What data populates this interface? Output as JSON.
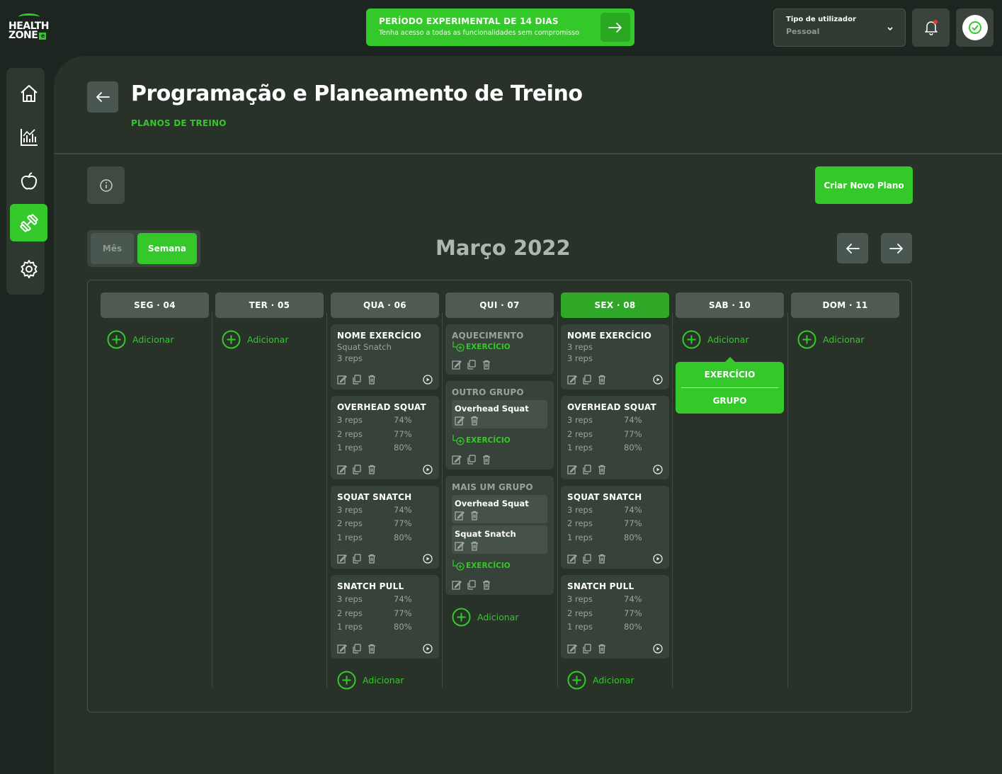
{
  "brand": {
    "line1": "HEALTH",
    "line2": "ZONE",
    "badge": "e"
  },
  "trial": {
    "title": "PERÍODO EXPERIMENTAL DE 14 DIAS",
    "subtitle": "Tenha acesso a todas as funcionalidades sem compromisso",
    "icon": "arrow-right-icon"
  },
  "user_type": {
    "label": "Tipo de utilizador",
    "value": "Pessoal"
  },
  "colors": {
    "accent": "#35c82a",
    "background": "#1c2520",
    "panel": "#283229",
    "card": "#37423a",
    "notification": "#e53b2c"
  },
  "sidebar": {
    "items": [
      {
        "name": "home",
        "icon": "home-icon",
        "active": false
      },
      {
        "name": "stats",
        "icon": "chart-icon",
        "active": false
      },
      {
        "name": "nutrition",
        "icon": "apple-icon",
        "active": false
      },
      {
        "name": "training",
        "icon": "dumbbell-icon",
        "active": true
      },
      {
        "name": "settings",
        "icon": "gear-icon",
        "active": false
      }
    ]
  },
  "page": {
    "title": "Programação e Planeamento de Treino",
    "subtitle": "PLANOS DE TREINO",
    "create_button": "Criar Novo Plano"
  },
  "view_toggle": {
    "month": "Mês",
    "week": "Semana",
    "selected": "Semana"
  },
  "calendar": {
    "month_label": "Março 2022",
    "add_label": "Adicionar",
    "days": [
      {
        "label": "SEG · 04"
      },
      {
        "label": "TER · 05"
      },
      {
        "label": "QUA · 06"
      },
      {
        "label": "QUI · 07"
      },
      {
        "label": "SEX · 08"
      },
      {
        "label": "SAB · 10"
      },
      {
        "label": "DOM · 11"
      }
    ],
    "wed": {
      "card0": {
        "title": "NOME EXERCÍCIO",
        "line1": "Squat Snatch",
        "line2": "3 reps"
      },
      "card1": {
        "title": "OVERHEAD SQUAT",
        "rows": [
          {
            "reps": "3 reps",
            "pct": "74%"
          },
          {
            "reps": "2 reps",
            "pct": "77%"
          },
          {
            "reps": "1 reps",
            "pct": "80%"
          }
        ]
      },
      "card2": {
        "title": "SQUAT SNATCH",
        "rows": [
          {
            "reps": "3 reps",
            "pct": "74%"
          },
          {
            "reps": "2 reps",
            "pct": "77%"
          },
          {
            "reps": "1 reps",
            "pct": "80%"
          }
        ]
      },
      "card3": {
        "title": "SNATCH PULL",
        "rows": [
          {
            "reps": "3 reps",
            "pct": "74%"
          },
          {
            "reps": "2 reps",
            "pct": "77%"
          },
          {
            "reps": "1 reps",
            "pct": "80%"
          }
        ]
      }
    },
    "thu": {
      "group0": {
        "title": "AQUECIMENTO",
        "link": "EXERCÍCIO"
      },
      "group1": {
        "title": "OUTRO GRUPO",
        "items": [
          "Overhead Squat"
        ],
        "link": "EXERCÍCIO"
      },
      "group2": {
        "title": "MAIS UM GRUPO",
        "items": [
          "Overhead Squat",
          "Squat Snatch"
        ],
        "link": "EXERCÍCIO"
      }
    },
    "fri": {
      "card0": {
        "title": "NOME EXERCÍCIO",
        "line1": "3 reps",
        "line2": "3 reps"
      },
      "card1": {
        "title": "OVERHEAD SQUAT",
        "rows": [
          {
            "reps": "3 reps",
            "pct": "74%"
          },
          {
            "reps": "2 reps",
            "pct": "77%"
          },
          {
            "reps": "1 reps",
            "pct": "80%"
          }
        ]
      },
      "card2": {
        "title": "SQUAT SNATCH",
        "rows": [
          {
            "reps": "3 reps",
            "pct": "74%"
          },
          {
            "reps": "2 reps",
            "pct": "77%"
          },
          {
            "reps": "1 reps",
            "pct": "80%"
          }
        ]
      },
      "card3": {
        "title": "SNATCH PULL",
        "rows": [
          {
            "reps": "3 reps",
            "pct": "74%"
          },
          {
            "reps": "2 reps",
            "pct": "77%"
          },
          {
            "reps": "1 reps",
            "pct": "80%"
          }
        ]
      }
    },
    "sat_dropdown": {
      "option1": "EXERCÍCIO",
      "option2": "GRUPO"
    }
  }
}
